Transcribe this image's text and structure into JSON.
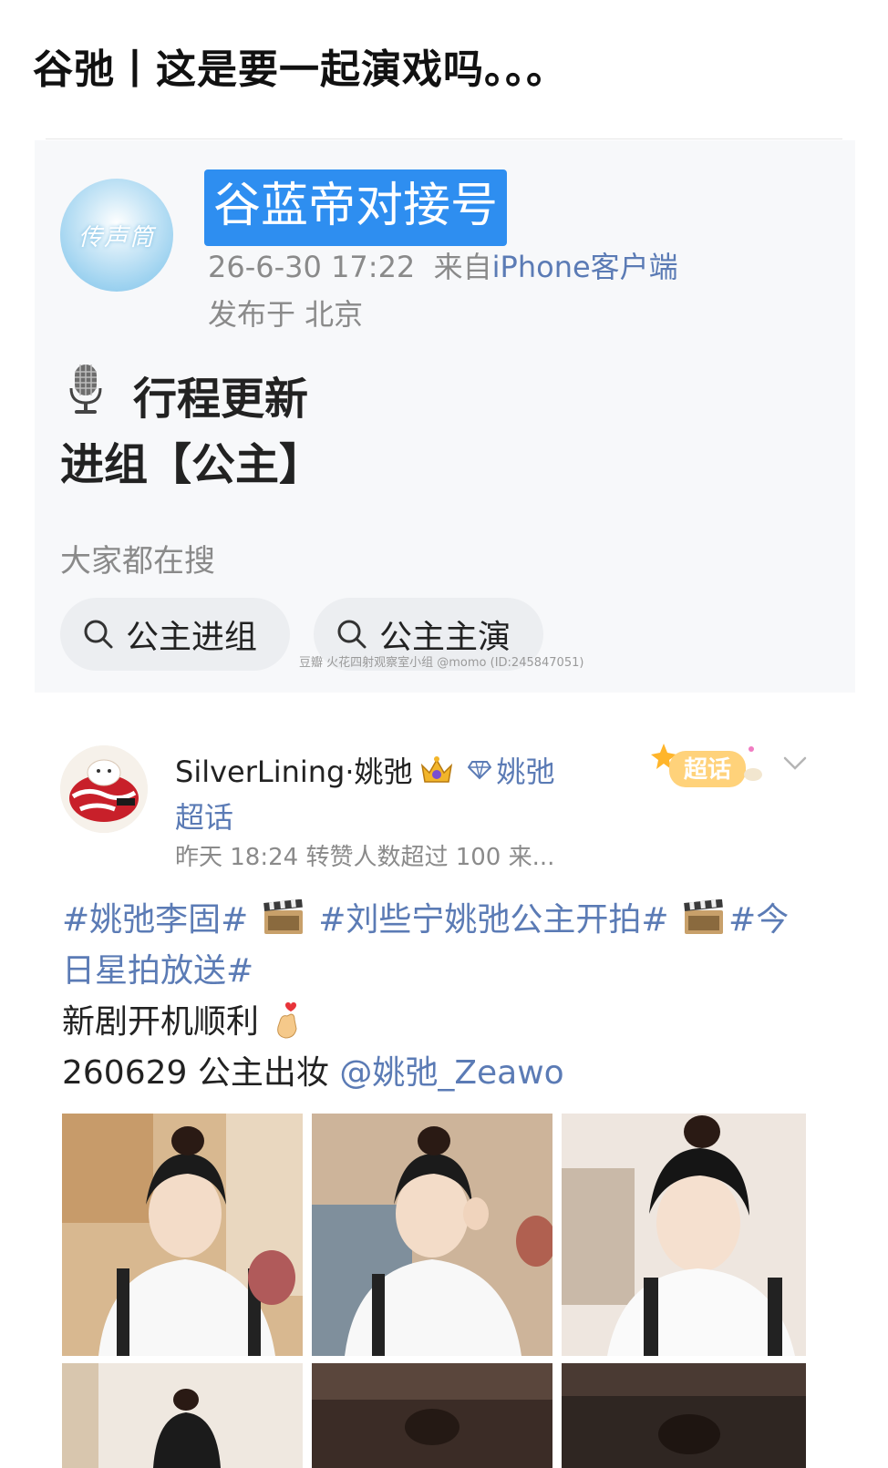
{
  "page": {
    "title": "谷弛丨这是要一起演戏吗。。。"
  },
  "post1": {
    "avatar_text": "传声筒",
    "author": "谷蓝帝对接号",
    "time": "26-6-30 17:22",
    "source_prefix": "来自",
    "source_client": "iPhone客户端",
    "location": "发布于 北京",
    "line1": "行程更新",
    "line2": "进组【公主】",
    "search_heading": "大家都在搜",
    "search_chips": [
      "公主进组",
      "公主主演"
    ],
    "watermark": "豆瓣 火花四射观察室小组 @momo (ID:245847051)"
  },
  "post2": {
    "author": "SilverLining·姚弛",
    "topic_link": "姚弛",
    "topic_link_line2": "超话",
    "badge_label": "超话",
    "meta": "昨天 18:24 转赞人数超过 100 来...",
    "tag1": "#姚弛李固#",
    "tag2": "#刘些宁姚弛公主开拍#",
    "tag3": "#今日星拍放送#",
    "line_wish": "新剧开机顺利",
    "line_date": "260629 公主出妆",
    "mention": "@姚弛_Zeawo"
  },
  "colors": {
    "link": "#5b7bb5",
    "author_highlight": "#2e8ef0",
    "meta_gray": "#8a8a8a"
  },
  "icons": [
    "microphone-icon",
    "search-icon",
    "crown-icon",
    "diamond-icon",
    "chevron-down-icon",
    "clapper-icon",
    "heart-hand-icon"
  ]
}
